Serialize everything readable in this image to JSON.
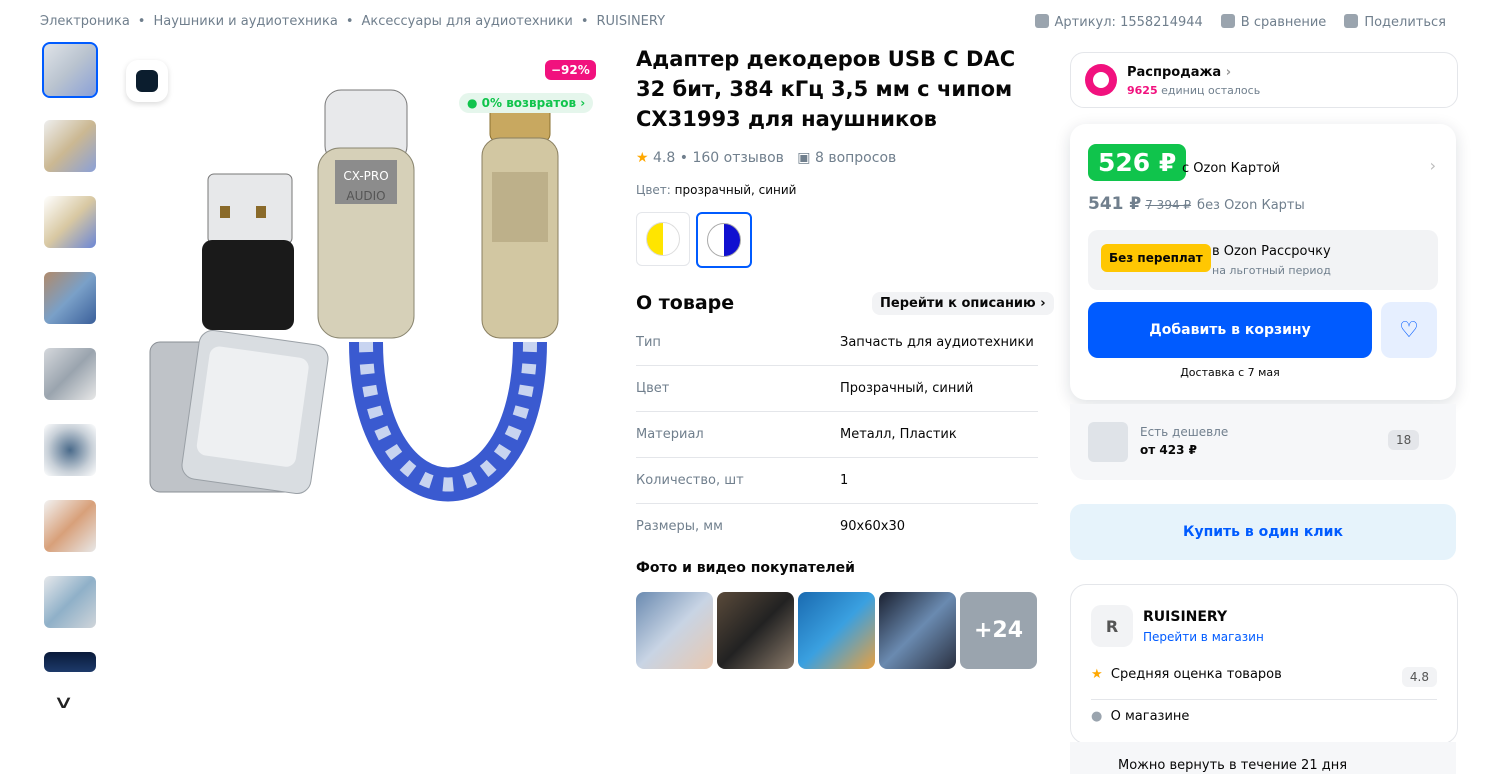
{
  "breadcrumbs": [
    "Электроника",
    "Наушники и аудиотехника",
    "Аксессуары для аудиотехники",
    "RUISINERY"
  ],
  "header_actions": {
    "article": "Артикул: 1558214944",
    "compare": "В сравнение",
    "share": "Поделиться"
  },
  "product": {
    "discount_badge": "−92%",
    "returns_badge": "0% возвратов",
    "title": "Адаптер декодеров USB C DAC 32 бит, 384 кГц 3,5 мм с чипом CX31993 для наушников",
    "rating": "4.8",
    "reviews": "160 отзывов",
    "questions": "8 вопросов",
    "color_label": "Цвет:",
    "color_value": "прозрачный, синий"
  },
  "about": {
    "title": "О товаре",
    "to_description": "Перейти к описанию",
    "props": [
      {
        "k": "Тип",
        "v": "Запчасть для аудиотехники"
      },
      {
        "k": "Цвет",
        "v": "Прозрачный, синий"
      },
      {
        "k": "Материал",
        "v": "Металл, Пластик"
      },
      {
        "k": "Количество, шт",
        "v": "1"
      },
      {
        "k": "Размеры, мм",
        "v": "90x60x30"
      }
    ]
  },
  "customer_photos": {
    "title": "Фото и видео покупателей",
    "more": "+24"
  },
  "sale": {
    "title": "Распродажа",
    "count": "9625",
    "remaining": "единиц осталось"
  },
  "buybox": {
    "price_card": "526 ₽",
    "price_card_label": "с Ozon Картой",
    "price": "541 ₽",
    "old_price": "7 394 ₽",
    "price_label": "без Ozon Карты",
    "installment_badge": "Без переплат",
    "installment_title": "в Ozon Рассрочку",
    "installment_sub": "на льготный период",
    "add_to_cart": "Добавить в корзину",
    "delivery": "Доставка с 7 мая"
  },
  "cheaper": {
    "label": "Есть дешевле",
    "price": "от 423 ₽",
    "count": "18"
  },
  "one_click": "Купить в один клик",
  "seller": {
    "initial": "R",
    "name": "RUISINERY",
    "go": "Перейти в магазин",
    "rating_label": "Средняя оценка товаров",
    "rating": "4.8",
    "about": "О магазине"
  },
  "return_policy": "Можно вернуть в течение 21 дня",
  "colors": {
    "accent": "#005bff",
    "sale": "#f1117e",
    "green": "#10c44c"
  }
}
